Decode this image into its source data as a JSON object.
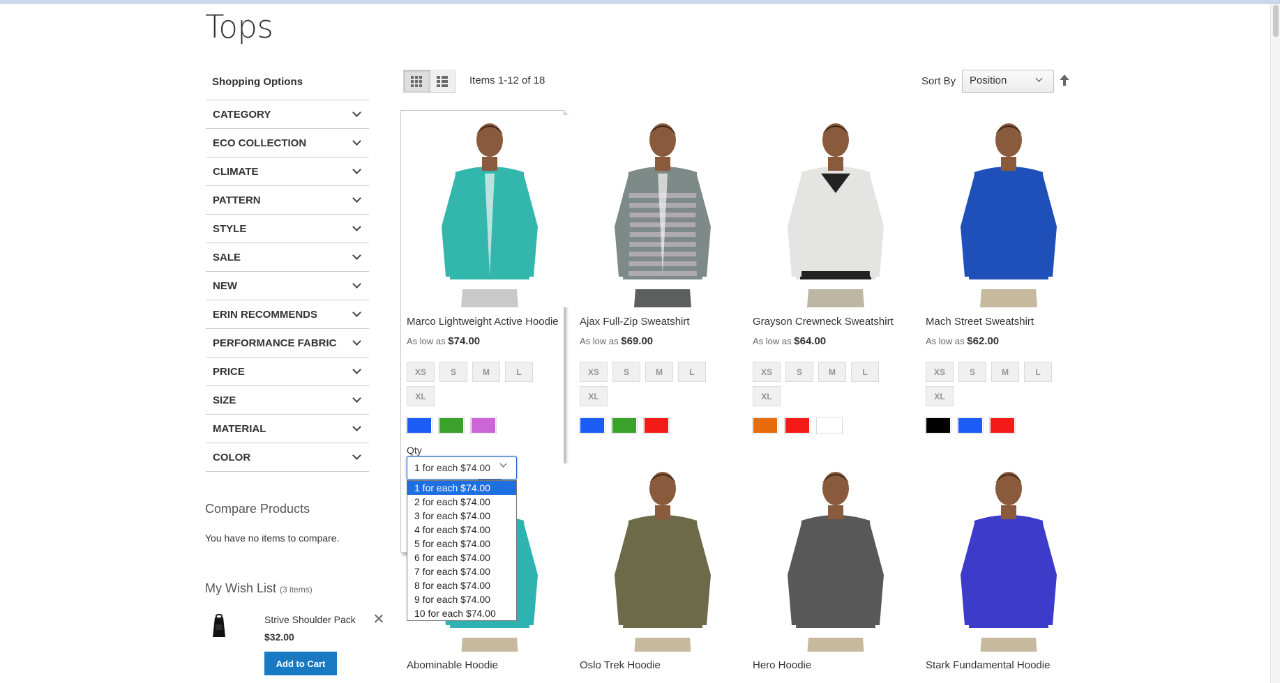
{
  "page": {
    "title": "Tops"
  },
  "sidebar": {
    "title": "Shopping Options",
    "filters": [
      {
        "label": "CATEGORY"
      },
      {
        "label": "ECO COLLECTION"
      },
      {
        "label": "CLIMATE"
      },
      {
        "label": "PATTERN"
      },
      {
        "label": "STYLE"
      },
      {
        "label": "SALE"
      },
      {
        "label": "NEW"
      },
      {
        "label": "ERIN RECOMMENDS"
      },
      {
        "label": "PERFORMANCE FABRIC"
      },
      {
        "label": "PRICE"
      },
      {
        "label": "SIZE"
      },
      {
        "label": "MATERIAL"
      },
      {
        "label": "COLOR"
      }
    ],
    "compare": {
      "title": "Compare Products",
      "empty": "You have no items to compare."
    },
    "wishlist": {
      "title": "My Wish List",
      "count": "(3 items)",
      "item_name": "Strive Shoulder Pack",
      "item_price": "$32.00",
      "add_to_cart": "Add to Cart"
    }
  },
  "toolbar": {
    "items_count": "Items 1-12 of 18",
    "sort_label": "Sort By",
    "sort_value": "Position"
  },
  "sizes": [
    "XS",
    "S",
    "M",
    "L",
    "XL"
  ],
  "products": [
    {
      "name": "Marco Lightweight Active Hoodie",
      "price_prefix": "As low as",
      "price": "$74.00",
      "colors": [
        "#1b5cf7",
        "#3aa12b",
        "#cc66d6"
      ],
      "garment": "#33b7ad"
    },
    {
      "name": "Ajax Full-Zip Sweatshirt",
      "price_prefix": "As low as",
      "price": "$69.00",
      "colors": [
        "#1b5cf7",
        "#3aa12b",
        "#f41a17"
      ],
      "garment": "#7d8a88"
    },
    {
      "name": "Grayson Crewneck Sweatshirt",
      "price_prefix": "As low as",
      "price": "$64.00",
      "colors": [
        "#e86c0d",
        "#f41a17",
        "#ffffff"
      ],
      "garment": "#e4e4e2"
    },
    {
      "name": "Mach Street Sweatshirt",
      "price_prefix": "As low as",
      "price": "$62.00",
      "colors": [
        "#000000",
        "#1b5cf7",
        "#f41a17"
      ],
      "garment": "#1f4fb8"
    }
  ],
  "products_row2": [
    {
      "name": "Abominable Hoodie",
      "garment": "#2fb3b0"
    },
    {
      "name": "Oslo Trek Hoodie",
      "garment": "#6d6a4a"
    },
    {
      "name": "Hero Hoodie",
      "garment": "#585858"
    },
    {
      "name": "Stark Fundamental Hoodie",
      "garment": "#3d3bc9"
    }
  ],
  "qty": {
    "label": "Qty",
    "selected": "1 for each $74.00",
    "options": [
      "1 for each $74.00",
      "2 for each $74.00",
      "3 for each $74.00",
      "4 for each $74.00",
      "5 for each $74.00",
      "6 for each $74.00",
      "7 for each $74.00",
      "8 for each $74.00",
      "9 for each $74.00",
      "10 for each $74.00"
    ]
  }
}
